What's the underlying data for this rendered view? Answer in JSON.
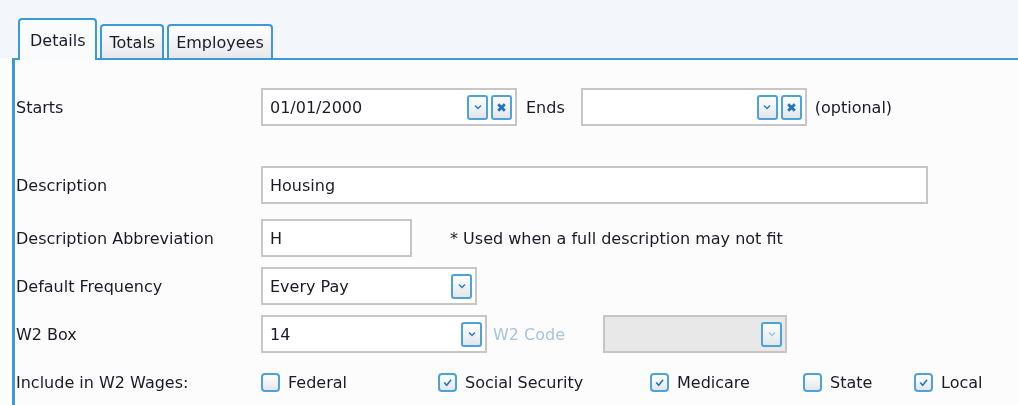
{
  "tabs": [
    {
      "label": "Details",
      "selected": true
    },
    {
      "label": "Totals",
      "selected": false
    },
    {
      "label": "Employees",
      "selected": false
    }
  ],
  "starts": {
    "label": "Starts",
    "value": "01/01/2000"
  },
  "ends": {
    "label": "Ends",
    "note": "(optional)"
  },
  "description": {
    "label": "Description",
    "value": "Housing"
  },
  "abbreviation": {
    "label": "Description Abbreviation",
    "value": "H",
    "note": "* Used when a full description may not fit"
  },
  "frequency": {
    "label": "Default Frequency",
    "value": "Every Pay"
  },
  "w2_box": {
    "label": "W2 Box",
    "value": "14"
  },
  "w2_code": {
    "label": "W2 Code",
    "disabled": true
  },
  "wages": {
    "label": "Include in W2 Wages:",
    "options": [
      {
        "label": "Federal",
        "checked": false
      },
      {
        "label": "Social Security",
        "checked": true
      },
      {
        "label": "Medicare",
        "checked": true
      },
      {
        "label": "State",
        "checked": false
      },
      {
        "label": "Local",
        "checked": true
      }
    ]
  }
}
